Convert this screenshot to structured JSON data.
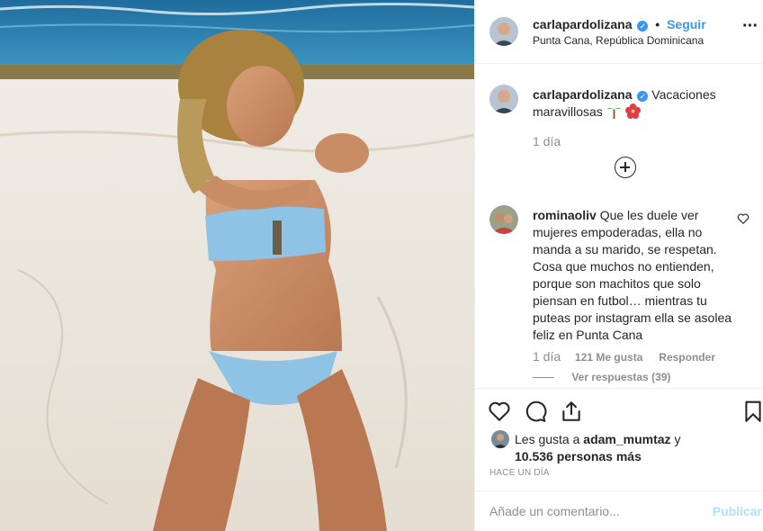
{
  "header": {
    "username": "carlapardolizana",
    "separator": "•",
    "follow_label": "Seguir",
    "location": "Punta Cana, República Dominicana",
    "more_icon": "ellipsis-icon"
  },
  "caption": {
    "username": "carlapardolizana",
    "text": "Vacaciones maravillosas",
    "emojis": [
      "palm-tree-icon",
      "hibiscus-icon"
    ],
    "time": "1 día"
  },
  "load_more_icon": "plus-circle-icon",
  "comment": {
    "username": "rominaoliv",
    "text": "Que les duele ver mujeres empoderadas, ella no manda a su marido, se respetan. Cosa que muchos no entienden, porque son machitos que solo piensan en futbol… mientras tu puteas por instagram ella se asolea feliz en Punta Cana",
    "time": "1 día",
    "likes": "121 Me gusta",
    "reply_label": "Responder",
    "view_replies": "Ver respuestas (39)"
  },
  "actions": {
    "like_icon": "heart-icon",
    "comment_icon": "comment-icon",
    "share_icon": "share-icon",
    "save_icon": "bookmark-icon"
  },
  "likes": {
    "prefix": "Les gusta a",
    "user": "adam_mumtaz",
    "conjunction": "y",
    "others": "10.536 personas más"
  },
  "posted_ago": "Hace un día",
  "comment_input": {
    "placeholder": "Añade un comentario...",
    "publish_label": "Publicar"
  },
  "colors": {
    "accent": "#3897f0",
    "publish_disabled": "#b2dffc",
    "muted": "#8e8e8e",
    "text": "#262626"
  }
}
